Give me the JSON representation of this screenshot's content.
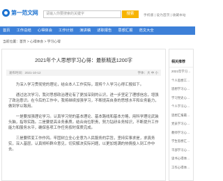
{
  "header": {
    "logo_text": "第一范文网",
    "search_placeholder": "请输入你要搜索的关键字",
    "search_button": "搜索",
    "top_links": "手机版 | 设为首页 | 收藏本站"
  },
  "nav": {
    "items": [
      "首页",
      "工作总结",
      "心得体会",
      "工作计划",
      "演讲稿",
      "述职报告",
      "思想汇报",
      "范文大全"
    ]
  },
  "breadcrumb": "当前位置：首页 > 心得体会 > 学习心得",
  "article": {
    "title": "2021年个人思想学习心得：最新精选1200字",
    "meta_left": "发布时间：2021-10-12",
    "meta_right": "字体：大 中 小",
    "paragraphs": [
      "为深入学习贯彻党的理论，结合本人工作实际，现将个人学习心得汇报如下。",
      "通过这次学习，我对思想政治理论有了更加深刻的认识，进一步坚定了理想信念，增强了政治意识。在今后的工作中，我将继续加强学习，不断提高自身的思想水平和业务能力，做到学以致用。",
      "一是要加强理论学习。认真学习党的基本理论、基本路线和基本方略，用科学理论武装头脑，指导实践。二是要提高业务素质。结合岗位职责，努力钻研业务知识，不断提升工作能力和服务水平，确保各项工作任务按时保质完成。",
      "三是要转变工作作风。牢固树立全心全意为人民服务的宗旨，坚持实事求是，求真务实，深入基层，认真倾听群众意见，切实解决实际问题，以更加饱满的热情投入到工作中去。"
    ]
  },
  "sidebar": {
    "title": "相关推荐",
    "items": [
      "2021年学习心得体会",
      "个人思想工作总结",
      "思想学习心得体会",
      "学习党史心得体会",
      "个人学习心得范文",
      "思想汇报最新精选",
      "党员学习心得体会",
      "教师学习心得体会",
      "学生思想汇报范文",
      "干部学习心得体会",
      "读书心得体会范文",
      "工作心得体会精选"
    ]
  },
  "colors": {
    "brand_blue": "#1f74d1",
    "nav_blue": "#3d80d8",
    "search_button": "#f7b400"
  }
}
